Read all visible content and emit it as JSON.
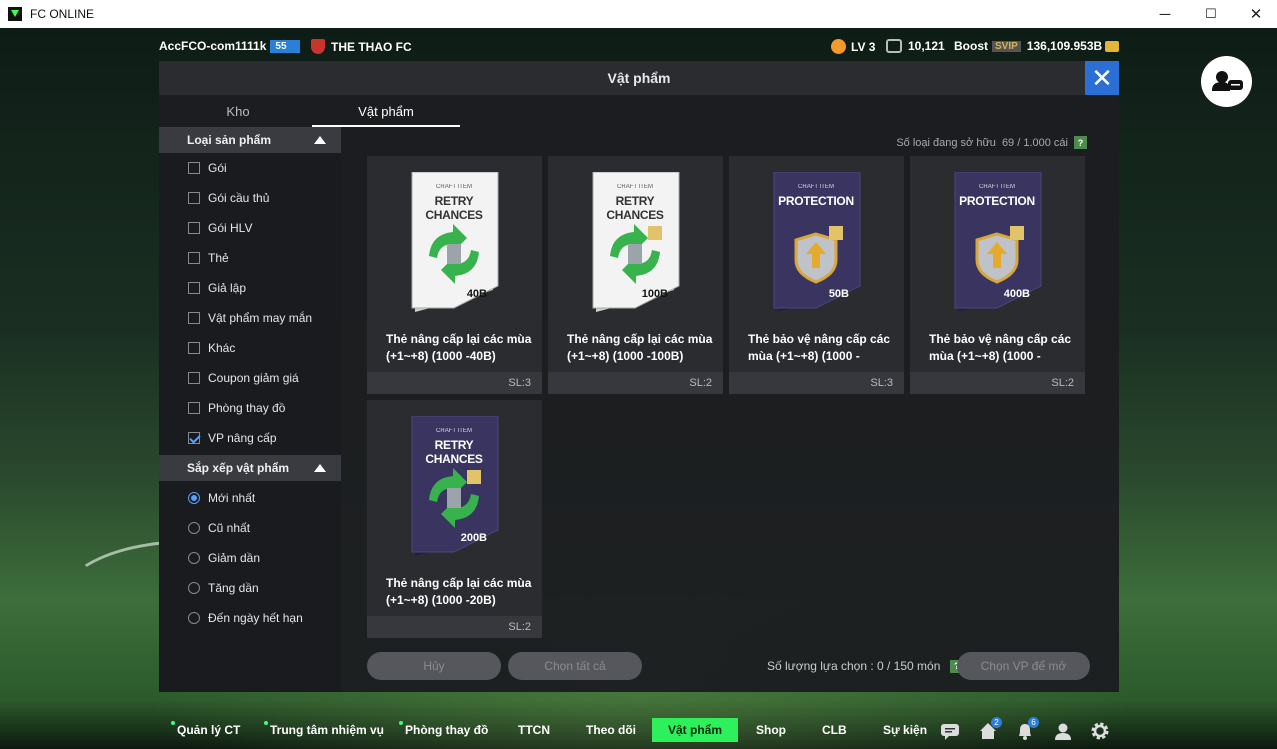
{
  "window": {
    "title": "FC ONLINE",
    "minimize": "─",
    "maximize": "☐",
    "close": "✕"
  },
  "topbar": {
    "account": "AccFCO-com1111k",
    "level_badge": "55",
    "club": "THE THAO FC",
    "lv": "LV 3",
    "fc_points": "10,121",
    "boost_label": "Boost",
    "boost_tier": "SVIP",
    "balance": "136,109.953B"
  },
  "panel": {
    "title": "Vật phẩm",
    "close": "✕",
    "tabs": [
      {
        "label": "Kho",
        "active": false
      },
      {
        "label": "Vật phẩm",
        "active": true
      }
    ],
    "owned_label": "Số loại đang sở hữu",
    "owned_value": "69 / 1.000 cái",
    "help": "?",
    "filter": {
      "title": "Loại sản phẩm",
      "options": [
        {
          "label": "Gói",
          "checked": false
        },
        {
          "label": "Gói cầu thủ",
          "checked": false
        },
        {
          "label": "Gói HLV",
          "checked": false
        },
        {
          "label": "Thẻ",
          "checked": false
        },
        {
          "label": "Giả lập",
          "checked": false
        },
        {
          "label": "Vật phẩm may mắn",
          "checked": false
        },
        {
          "label": "Khác",
          "checked": false
        },
        {
          "label": "Coupon giảm giá",
          "checked": false
        },
        {
          "label": "Phòng thay đồ",
          "checked": false
        },
        {
          "label": "VP nâng cấp",
          "checked": true
        }
      ]
    },
    "sort": {
      "title": "Sắp xếp vật phẩm",
      "options": [
        {
          "label": "Mới nhất",
          "selected": true
        },
        {
          "label": "Cũ nhất",
          "selected": false
        },
        {
          "label": "Giảm dần",
          "selected": false
        },
        {
          "label": "Tăng dần",
          "selected": false
        },
        {
          "label": "Đến ngày hết hạn",
          "selected": false
        }
      ]
    },
    "items": [
      {
        "name": "Thẻ nâng cấp lại các mùa (+1~+8) (1000 -40B)",
        "qty": "SL:3",
        "craft": "CRAFT ITEM",
        "type": "RETRY CHANCES",
        "value": "40B",
        "style": "white"
      },
      {
        "name": "Thẻ nâng cấp lại các mùa (+1~+8) (1000 -100B)",
        "qty": "SL:2",
        "craft": "CRAFT ITEM",
        "type": "RETRY CHANCES",
        "value": "100B",
        "style": "white"
      },
      {
        "name": "Thẻ bảo vệ nâng cấp các mùa (+1~+8) (1000 -",
        "qty": "SL:3",
        "craft": "CRAFT ITEM",
        "type": "PROTECTION",
        "value": "50B",
        "style": "purple"
      },
      {
        "name": "Thẻ bảo vệ nâng cấp các mùa (+1~+8) (1000 -",
        "qty": "SL:2",
        "craft": "CRAFT ITEM",
        "type": "PROTECTION",
        "value": "400B",
        "style": "purple"
      },
      {
        "name": "Thẻ nâng cấp lại các mùa (+1~+8) (1000 -20B)",
        "qty": "SL:2",
        "craft": "CRAFT ITEM",
        "type": "RETRY CHANCES",
        "value": "200B",
        "style": "purple"
      }
    ],
    "buttons": {
      "cancel": "Hủy",
      "select_all": "Chọn tất cả",
      "select_item": "Chọn VP để mở"
    },
    "selection_label": "Số lượng lựa chọn : 0 / 150 món"
  },
  "bottom_nav": {
    "items": [
      {
        "label": "Quản lý CT",
        "dot": true
      },
      {
        "label": "Trung tâm nhiệm vụ",
        "dot": true
      },
      {
        "label": "Phòng thay đồ",
        "dot": true
      },
      {
        "label": "TTCN",
        "dot": false
      },
      {
        "label": "Theo dõi",
        "dot": false
      },
      {
        "label": "Vật phẩm",
        "dot": false,
        "active": true
      },
      {
        "label": "Shop",
        "dot": false
      },
      {
        "label": "CLB",
        "dot": false
      },
      {
        "label": "Sự kiện",
        "dot": false
      }
    ],
    "badges": {
      "home": "2",
      "bell": "6"
    }
  },
  "colors": {
    "accent_green": "#2ef05b",
    "accent_blue": "#2b6ed4"
  }
}
